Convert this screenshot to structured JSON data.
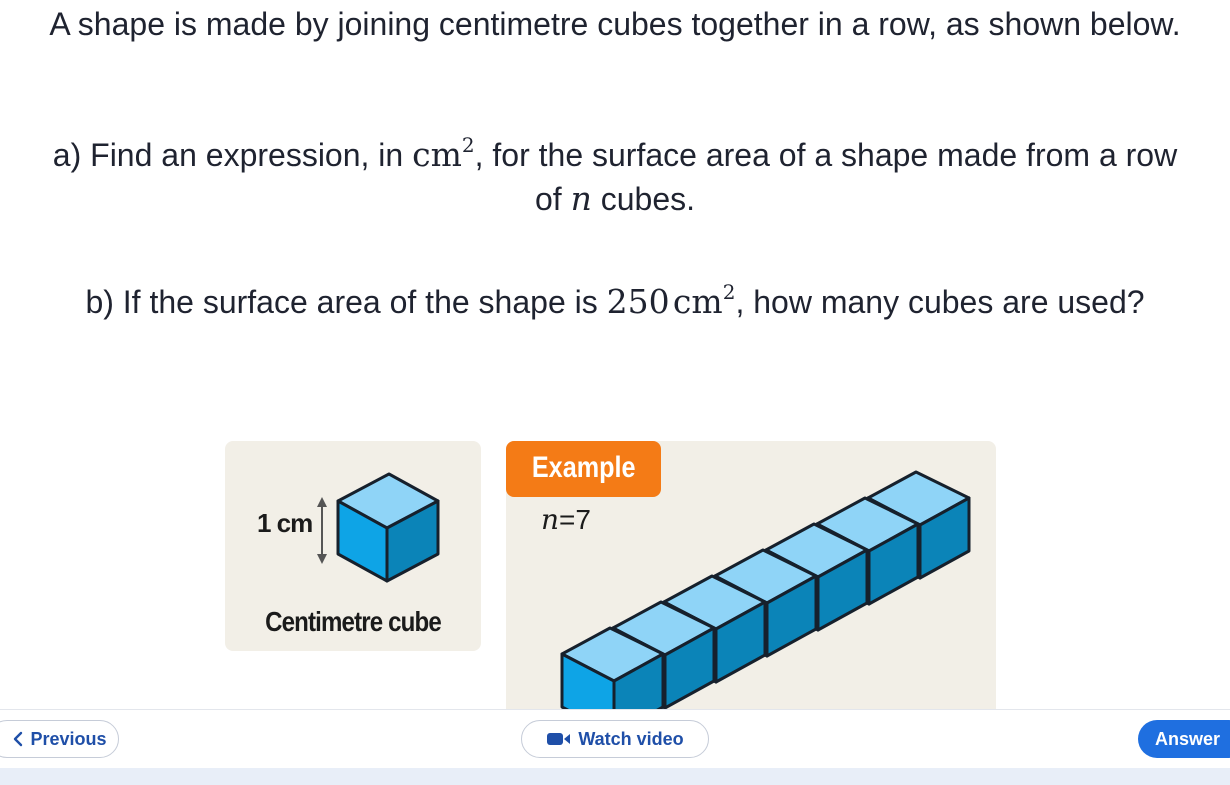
{
  "question": {
    "intro": "A shape is made by joining centimetre cubes together in a row, as shown below.",
    "part_a_prefix": "a) Find an expression, in",
    "part_a_unit": "cm",
    "part_a_exp": "2",
    "part_a_mid": ", for the surface area of a shape made from a row of",
    "part_a_var": "n",
    "part_a_suffix": "cubes.",
    "part_b_prefix": "b) If the surface area of the shape is",
    "part_b_value": "250",
    "part_b_unit": "cm",
    "part_b_exp": "2",
    "part_b_suffix": ", how many cubes are used?"
  },
  "figure": {
    "unit_label": "1 cm",
    "caption": "Centimetre cube",
    "example_label": "Example",
    "n_var": "n",
    "n_eq": "=",
    "n_value": "7",
    "cube_count_shown": 7,
    "colors": {
      "top": "#8fd4f7",
      "front": "#0ea4e6",
      "side": "#0b84b8",
      "outline": "#16202c",
      "panel": "#f2efe7",
      "badge": "#f47b16"
    }
  },
  "footer": {
    "previous": "Previous",
    "watch_video": "Watch video",
    "answer": "Answer"
  }
}
